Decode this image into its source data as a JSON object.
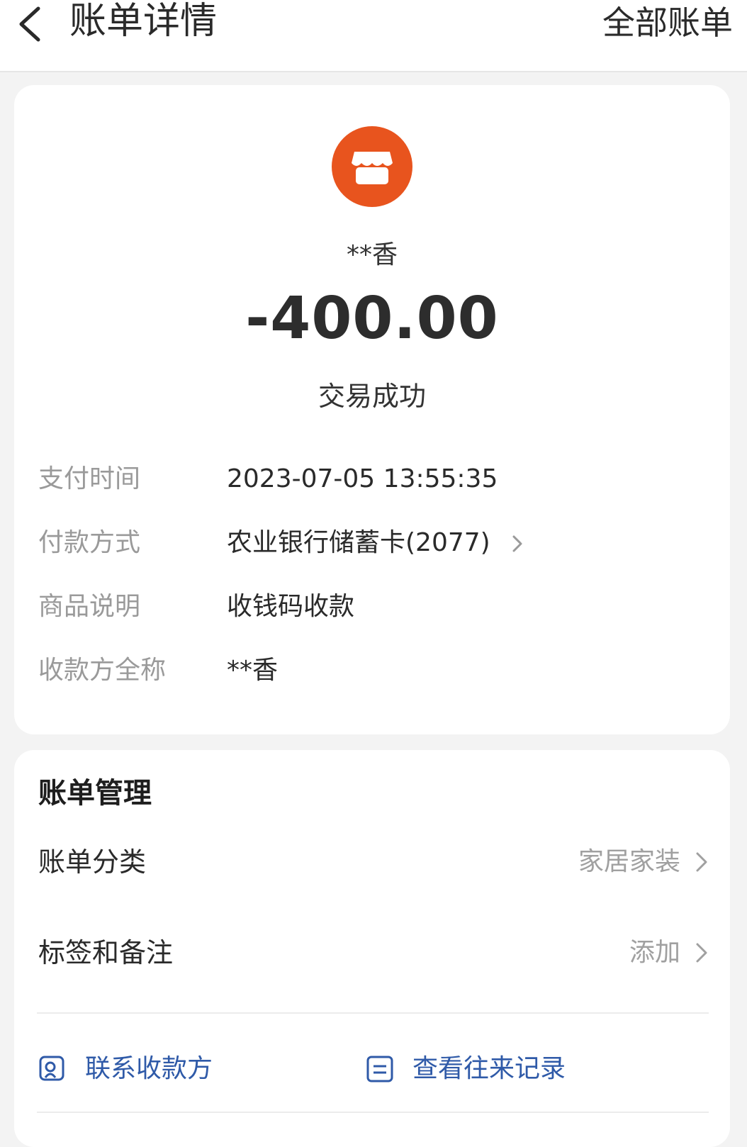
{
  "header": {
    "title": "账单详情",
    "right_link": "全部账单"
  },
  "summary": {
    "payee": "**香",
    "amount": "-400.00",
    "status": "交易成功"
  },
  "details": [
    {
      "label": "支付时间",
      "value": "2023-07-05 13:55:35"
    },
    {
      "label": "付款方式",
      "value": "农业银行储蓄卡(2077)"
    },
    {
      "label": "商品说明",
      "value": "收钱码收款"
    },
    {
      "label": "收款方全称",
      "value": "**香"
    }
  ],
  "management": {
    "title": "账单管理",
    "category_label": "账单分类",
    "category_value": "家居家装",
    "tags_label": "标签和备注",
    "tags_value": "添加"
  },
  "actions": {
    "contact": "联系收款方",
    "history": "查看往来记录"
  },
  "colors": {
    "accent": "#e8541e",
    "link": "#2f5aa8"
  },
  "icons": [
    "back-icon",
    "shop-icon",
    "chevron-right-icon",
    "contact-icon",
    "record-icon"
  ]
}
